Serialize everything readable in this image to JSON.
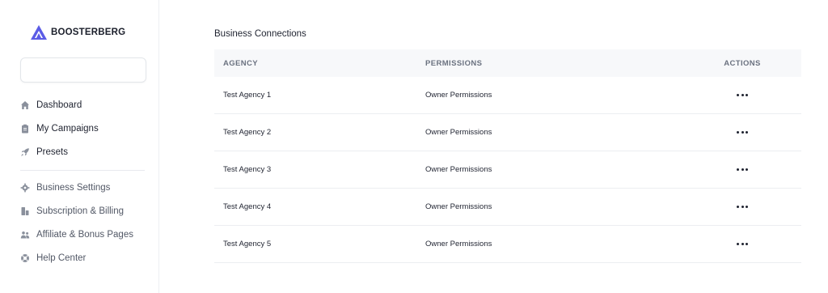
{
  "brand": {
    "name": "BOOSTERBERG",
    "accent": "#5b5ce6"
  },
  "sidebar": {
    "primary": [
      {
        "label": "Dashboard",
        "icon": "home-icon"
      },
      {
        "label": "My Campaigns",
        "icon": "clipboard-icon"
      },
      {
        "label": "Presets",
        "icon": "rocket-icon"
      }
    ],
    "secondary": [
      {
        "label": "Business Settings",
        "icon": "gear-icon"
      },
      {
        "label": "Subscription & Billing",
        "icon": "billing-icon"
      },
      {
        "label": "Affiliate & Bonus Pages",
        "icon": "users-icon"
      },
      {
        "label": "Help Center",
        "icon": "lifebuoy-icon"
      }
    ]
  },
  "main": {
    "title": "Business Connections",
    "table": {
      "headers": {
        "agency": "AGENCY",
        "permissions": "PERMISSIONS",
        "actions": "ACTIONS"
      },
      "rows": [
        {
          "agency": "Test Agency 1",
          "permissions": "Owner Permissions",
          "actions_icon": "more-horizontal-icon"
        },
        {
          "agency": "Test Agency 2",
          "permissions": "Owner Permissions",
          "actions_icon": "more-horizontal-icon"
        },
        {
          "agency": "Test Agency 3",
          "permissions": "Owner Permissions",
          "actions_icon": "more-horizontal-icon"
        },
        {
          "agency": "Test Agency 4",
          "permissions": "Owner Permissions",
          "actions_icon": "more-horizontal-icon"
        },
        {
          "agency": "Test Agency 5",
          "permissions": "Owner Permissions",
          "actions_icon": "more-horizontal-icon"
        }
      ]
    }
  }
}
